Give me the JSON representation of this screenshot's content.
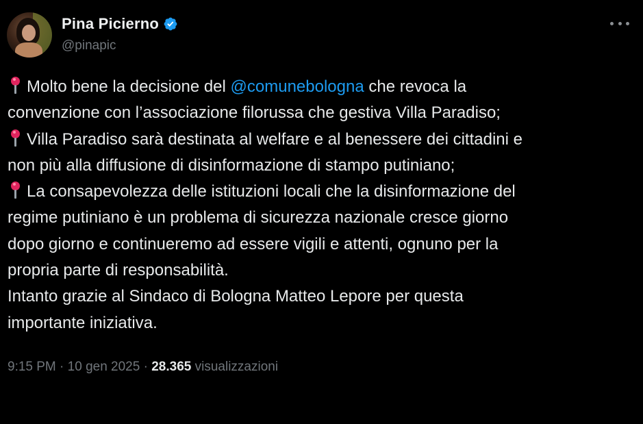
{
  "author": {
    "name": "Pina Picierno",
    "handle": "@pinapic"
  },
  "tweet": {
    "line1_pre": "Molto bene la decisione del ",
    "line1_mention": "@comunebologna",
    "line1_post": " che revoca la",
    "line2": "convenzione con l’associazione filorussa che gestiva Villa Paradiso;",
    "line3": "Villa Paradiso sarà destinata al welfare e al benessere dei cittadini e",
    "line4": "non più alla diffusione di disinformazione di stampo putiniano;",
    "line5": "La consapevolezza delle istituzioni locali che la disinformazione del",
    "line6": "regime putiniano è un problema di sicurezza nazionale cresce giorno",
    "line7": "dopo giorno e continueremo ad essere vigili e attenti, ognuno per la",
    "line8": "propria parte di responsabilità.",
    "line9": "Intanto grazie al Sindaco di Bologna Matteo Lepore per questa",
    "line10": "importante iniziativa."
  },
  "meta": {
    "time": "9:15 PM",
    "sep1": " · ",
    "date": "10 gen 2025",
    "sep2": " · ",
    "views_count": "28.365",
    "views_label": " visualizzazioni"
  },
  "icons": {
    "verified": "verified-badge-icon",
    "bullet": "round-pushpin-icon",
    "more": "more-options-icon"
  },
  "colors": {
    "background": "#000000",
    "text": "#e7e9ea",
    "secondary": "#71767b",
    "link": "#1d9bf0",
    "pin": "#e0245e"
  }
}
